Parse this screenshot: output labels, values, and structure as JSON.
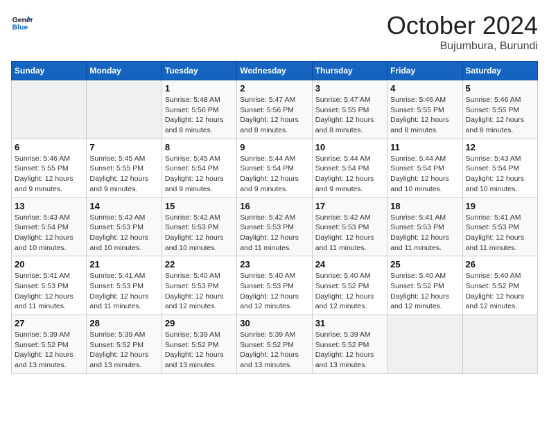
{
  "logo": {
    "line1": "General",
    "line2": "Blue"
  },
  "title": "October 2024",
  "subtitle": "Bujumbura, Burundi",
  "days_of_week": [
    "Sunday",
    "Monday",
    "Tuesday",
    "Wednesday",
    "Thursday",
    "Friday",
    "Saturday"
  ],
  "weeks": [
    [
      {
        "day": "",
        "info": ""
      },
      {
        "day": "",
        "info": ""
      },
      {
        "day": "1",
        "info": "Sunrise: 5:48 AM\nSunset: 5:56 PM\nDaylight: 12 hours and 8 minutes."
      },
      {
        "day": "2",
        "info": "Sunrise: 5:47 AM\nSunset: 5:56 PM\nDaylight: 12 hours and 8 minutes."
      },
      {
        "day": "3",
        "info": "Sunrise: 5:47 AM\nSunset: 5:55 PM\nDaylight: 12 hours and 8 minutes."
      },
      {
        "day": "4",
        "info": "Sunrise: 5:46 AM\nSunset: 5:55 PM\nDaylight: 12 hours and 8 minutes."
      },
      {
        "day": "5",
        "info": "Sunrise: 5:46 AM\nSunset: 5:55 PM\nDaylight: 12 hours and 8 minutes."
      }
    ],
    [
      {
        "day": "6",
        "info": "Sunrise: 5:46 AM\nSunset: 5:55 PM\nDaylight: 12 hours and 9 minutes."
      },
      {
        "day": "7",
        "info": "Sunrise: 5:45 AM\nSunset: 5:55 PM\nDaylight: 12 hours and 9 minutes."
      },
      {
        "day": "8",
        "info": "Sunrise: 5:45 AM\nSunset: 5:54 PM\nDaylight: 12 hours and 9 minutes."
      },
      {
        "day": "9",
        "info": "Sunrise: 5:44 AM\nSunset: 5:54 PM\nDaylight: 12 hours and 9 minutes."
      },
      {
        "day": "10",
        "info": "Sunrise: 5:44 AM\nSunset: 5:54 PM\nDaylight: 12 hours and 9 minutes."
      },
      {
        "day": "11",
        "info": "Sunrise: 5:44 AM\nSunset: 5:54 PM\nDaylight: 12 hours and 10 minutes."
      },
      {
        "day": "12",
        "info": "Sunrise: 5:43 AM\nSunset: 5:54 PM\nDaylight: 12 hours and 10 minutes."
      }
    ],
    [
      {
        "day": "13",
        "info": "Sunrise: 5:43 AM\nSunset: 5:54 PM\nDaylight: 12 hours and 10 minutes."
      },
      {
        "day": "14",
        "info": "Sunrise: 5:43 AM\nSunset: 5:53 PM\nDaylight: 12 hours and 10 minutes."
      },
      {
        "day": "15",
        "info": "Sunrise: 5:42 AM\nSunset: 5:53 PM\nDaylight: 12 hours and 10 minutes."
      },
      {
        "day": "16",
        "info": "Sunrise: 5:42 AM\nSunset: 5:53 PM\nDaylight: 12 hours and 11 minutes."
      },
      {
        "day": "17",
        "info": "Sunrise: 5:42 AM\nSunset: 5:53 PM\nDaylight: 12 hours and 11 minutes."
      },
      {
        "day": "18",
        "info": "Sunrise: 5:41 AM\nSunset: 5:53 PM\nDaylight: 12 hours and 11 minutes."
      },
      {
        "day": "19",
        "info": "Sunrise: 5:41 AM\nSunset: 5:53 PM\nDaylight: 12 hours and 11 minutes."
      }
    ],
    [
      {
        "day": "20",
        "info": "Sunrise: 5:41 AM\nSunset: 5:53 PM\nDaylight: 12 hours and 11 minutes."
      },
      {
        "day": "21",
        "info": "Sunrise: 5:41 AM\nSunset: 5:53 PM\nDaylight: 12 hours and 11 minutes."
      },
      {
        "day": "22",
        "info": "Sunrise: 5:40 AM\nSunset: 5:53 PM\nDaylight: 12 hours and 12 minutes."
      },
      {
        "day": "23",
        "info": "Sunrise: 5:40 AM\nSunset: 5:53 PM\nDaylight: 12 hours and 12 minutes."
      },
      {
        "day": "24",
        "info": "Sunrise: 5:40 AM\nSunset: 5:52 PM\nDaylight: 12 hours and 12 minutes."
      },
      {
        "day": "25",
        "info": "Sunrise: 5:40 AM\nSunset: 5:52 PM\nDaylight: 12 hours and 12 minutes."
      },
      {
        "day": "26",
        "info": "Sunrise: 5:40 AM\nSunset: 5:52 PM\nDaylight: 12 hours and 12 minutes."
      }
    ],
    [
      {
        "day": "27",
        "info": "Sunrise: 5:39 AM\nSunset: 5:52 PM\nDaylight: 12 hours and 13 minutes."
      },
      {
        "day": "28",
        "info": "Sunrise: 5:39 AM\nSunset: 5:52 PM\nDaylight: 12 hours and 13 minutes."
      },
      {
        "day": "29",
        "info": "Sunrise: 5:39 AM\nSunset: 5:52 PM\nDaylight: 12 hours and 13 minutes."
      },
      {
        "day": "30",
        "info": "Sunrise: 5:39 AM\nSunset: 5:52 PM\nDaylight: 12 hours and 13 minutes."
      },
      {
        "day": "31",
        "info": "Sunrise: 5:39 AM\nSunset: 5:52 PM\nDaylight: 12 hours and 13 minutes."
      },
      {
        "day": "",
        "info": ""
      },
      {
        "day": "",
        "info": ""
      }
    ]
  ]
}
